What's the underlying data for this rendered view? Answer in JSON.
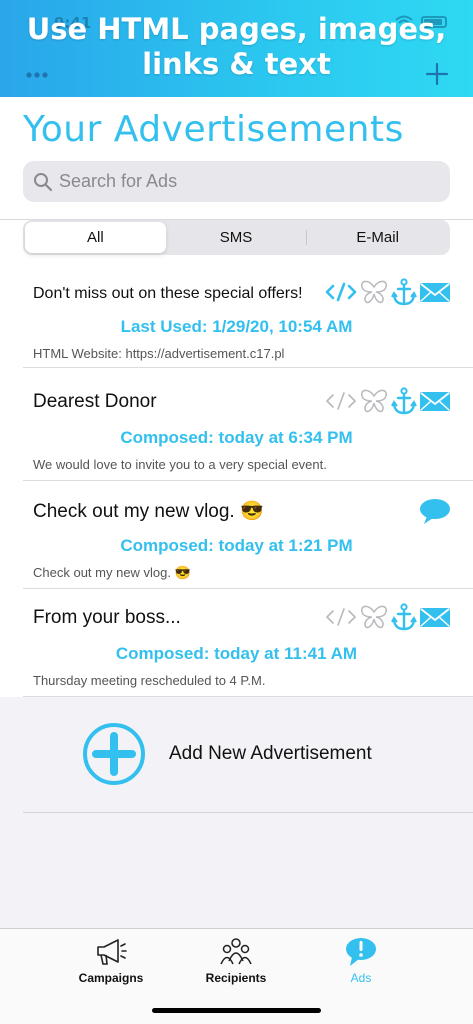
{
  "banner": {
    "title_line1": "Use HTML pages, images,",
    "title_line2": "links & text",
    "time": "9:41"
  },
  "header": {
    "title": "Your Advertisements",
    "search_placeholder": "Search for Ads"
  },
  "segments": [
    {
      "label": "All",
      "active": true
    },
    {
      "label": "SMS",
      "active": false
    },
    {
      "label": "E-Mail",
      "active": false
    }
  ],
  "ads": [
    {
      "title": "Don't miss out on these special offers!",
      "status": "Last Used: 1/29/20, 10:54 AM",
      "subtitle": "HTML Website: https://advertisement.c17.pl",
      "html_active": true,
      "icons": [
        "html-icon",
        "butterfly-icon",
        "anchor-icon",
        "mail-icon"
      ]
    },
    {
      "title": "Dearest Donor",
      "status": "Composed: today at 6:34 PM",
      "subtitle": "We would love to invite you to a very special event.",
      "html_active": false,
      "icons": [
        "html-icon",
        "butterfly-icon",
        "anchor-icon",
        "mail-icon"
      ]
    },
    {
      "title": "Check out my new vlog. 😎",
      "status": "Composed: today at 1:21 PM",
      "subtitle": "Check out my new vlog. 😎",
      "icons": [
        "chat-bubble-icon"
      ]
    },
    {
      "title": "From your boss...",
      "status": "Composed: today at 11:41 AM",
      "subtitle": "Thursday meeting rescheduled to 4 P.M.",
      "html_active": false,
      "icons": [
        "html-icon",
        "butterfly-icon",
        "anchor-icon",
        "mail-icon"
      ]
    }
  ],
  "add_new": {
    "label": "Add New Advertisement"
  },
  "tabs": [
    {
      "label": "Campaigns",
      "icon": "megaphone-icon"
    },
    {
      "label": "Recipients",
      "icon": "people-icon"
    },
    {
      "label": "Ads",
      "icon": "speech-bubble-icon",
      "active": true
    }
  ],
  "colors": {
    "accent": "#34c0ee",
    "inactive_icon": "#b8b8bd"
  }
}
